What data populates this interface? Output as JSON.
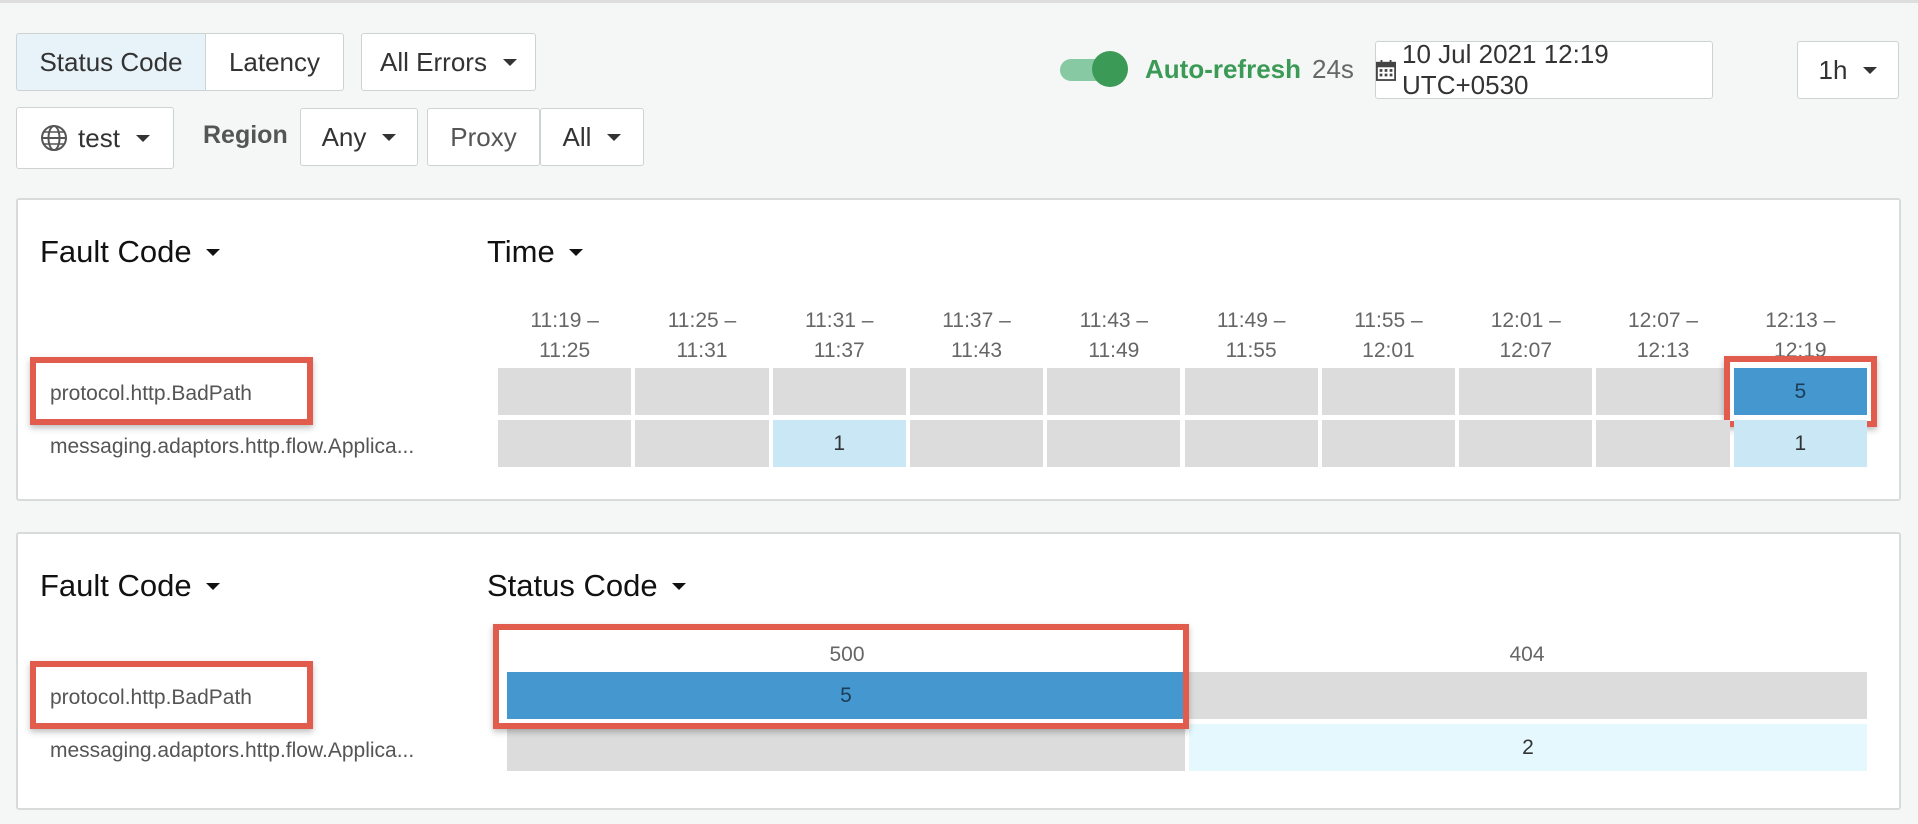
{
  "toolbar": {
    "tabs": [
      {
        "label": "Status Code",
        "active": true
      },
      {
        "label": "Latency",
        "active": false
      }
    ],
    "errors_filter": "All Errors",
    "environment": "test",
    "region_label": "Region",
    "region_value": "Any",
    "proxy_label": "Proxy",
    "proxy_value": "All",
    "auto_refresh": {
      "label": "Auto-refresh",
      "seconds": "24s",
      "enabled": true
    },
    "date": "10 Jul 2021 12:19 UTC+0530",
    "range": "1h"
  },
  "time_panel": {
    "row_heading": "Fault Code",
    "col_heading": "Time",
    "columns": [
      {
        "line1": "11:19 –",
        "line2": "11:25"
      },
      {
        "line1": "11:25 –",
        "line2": "11:31"
      },
      {
        "line1": "11:31 –",
        "line2": "11:37"
      },
      {
        "line1": "11:37 –",
        "line2": "11:43"
      },
      {
        "line1": "11:43 –",
        "line2": "11:49"
      },
      {
        "line1": "11:49 –",
        "line2": "11:55"
      },
      {
        "line1": "11:55 –",
        "line2": "12:01"
      },
      {
        "line1": "12:01 –",
        "line2": "12:07"
      },
      {
        "line1": "12:07 –",
        "line2": "12:13"
      },
      {
        "line1": "12:13 –",
        "line2": "12:19"
      }
    ],
    "rows": [
      {
        "label": "protocol.http.BadPath",
        "values": [
          "",
          "",
          "",
          "",
          "",
          "",
          "",
          "",
          "",
          "5"
        ]
      },
      {
        "label": "messaging.adaptors.http.flow.Applica...",
        "values": [
          "",
          "",
          "1",
          "",
          "",
          "",
          "",
          "",
          "",
          "1"
        ]
      }
    ]
  },
  "status_panel": {
    "row_heading": "Fault Code",
    "col_heading": "Status Code",
    "columns": [
      "500",
      "404"
    ],
    "rows": [
      {
        "label": "protocol.http.BadPath",
        "values": [
          "5",
          ""
        ]
      },
      {
        "label": "messaging.adaptors.http.flow.Applica...",
        "values": [
          "",
          "2"
        ]
      }
    ]
  },
  "icons": {
    "globe": "globe-icon",
    "calendar": "calendar-icon",
    "caret": "caret-down-icon"
  },
  "colors": {
    "accent_green": "#3c9a57",
    "cell_dark": "#4498cf",
    "cell_light": "#c9e7f5",
    "highlight": "#e15c4c"
  }
}
